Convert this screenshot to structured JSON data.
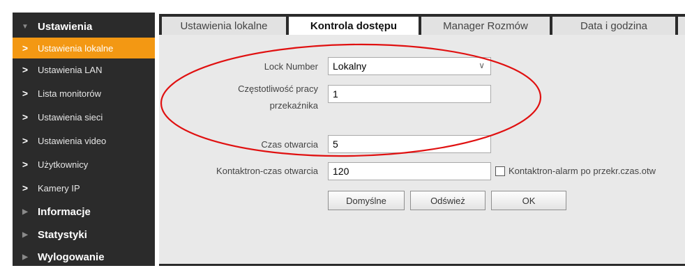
{
  "sidebar": {
    "sections": [
      {
        "label": "Ustawienia",
        "expanded": true
      },
      {
        "label": "Informacje",
        "expanded": false
      },
      {
        "label": "Statystyki",
        "expanded": false
      },
      {
        "label": "Wylogowanie",
        "expanded": false
      }
    ],
    "items": [
      {
        "label": "Ustawienia lokalne",
        "active": true
      },
      {
        "label": "Ustawienia LAN"
      },
      {
        "label": "Lista monitorów"
      },
      {
        "label": "Ustawienia sieci"
      },
      {
        "label": "Ustawienia video"
      },
      {
        "label": "Użytkownicy"
      },
      {
        "label": "Kamery IP"
      }
    ],
    "chevron": ">"
  },
  "tabs": [
    {
      "label": "Ustawienia lokalne"
    },
    {
      "label": "Kontrola dostępu",
      "active": true
    },
    {
      "label": "Manager Rozmów"
    },
    {
      "label": "Data i godzina"
    }
  ],
  "form": {
    "lock_number": {
      "label": "Lock Number",
      "value": "Lokalny"
    },
    "relay_frequency": {
      "label_line1": "Częstotliwość pracy",
      "label_line2": "przekaźnika",
      "value": "1"
    },
    "open_time": {
      "label": "Czas otwarcia",
      "value": "5"
    },
    "contact_open_time": {
      "label": "Kontaktron-czas otwarcia",
      "value": "120"
    },
    "contact_alarm": {
      "label": "Kontaktron-alarm po przekr.czas.otw",
      "checked": false
    }
  },
  "buttons": {
    "default": "Domyślne",
    "refresh": "Odśwież",
    "ok": "OK"
  },
  "colors": {
    "active_item": "#f39813",
    "sidebar_bg": "#2b2b2b",
    "annotation": "#e01010"
  }
}
